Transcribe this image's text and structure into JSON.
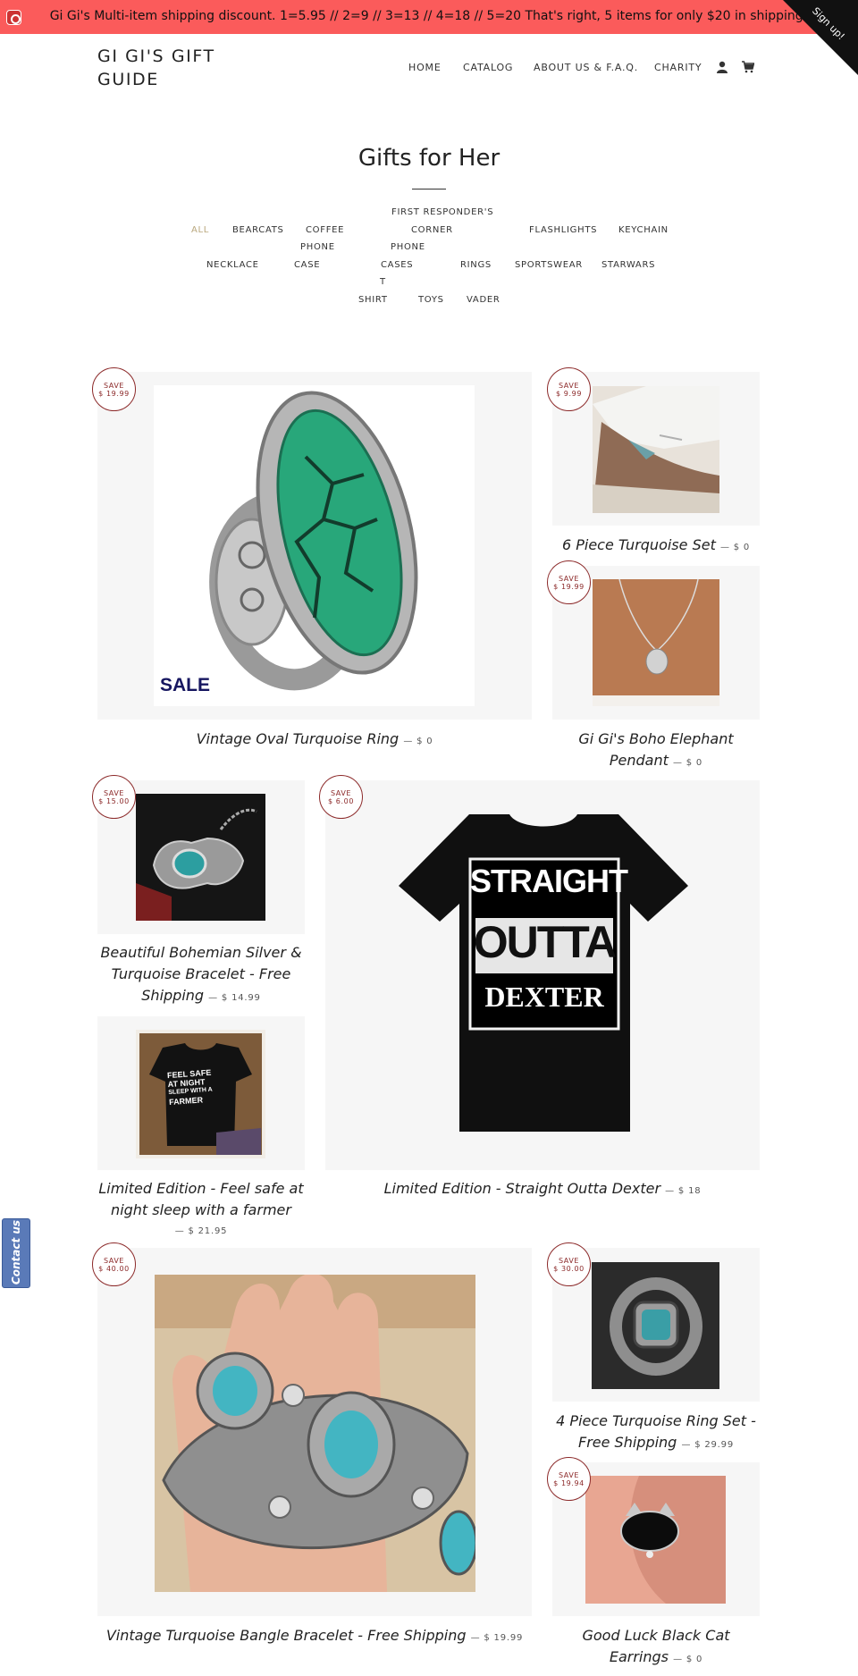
{
  "announcement": {
    "text": "Gi Gi's Multi-item shipping discount. 1=5.95 // 2=9 // 3=13 // 4=18 // 5=20 That's right, 5 items for only $20 in shipping!",
    "signup": "Sign up!"
  },
  "header": {
    "logo": "GI GI'S GIFT GUIDE",
    "nav": [
      "HOME",
      "CATALOG",
      "ABOUT US & F.A.Q.",
      "CHARITY"
    ]
  },
  "collection": {
    "title": "Gifts for Her",
    "tags": {
      "all": "ALL",
      "bearcats": "BEARCATS",
      "coffee": "COFFEE",
      "first_responders_line1": "FIRST RESPONDER'S",
      "first_responders_line2": "CORNER",
      "flashlights": "FLASHLIGHTS",
      "keychain": "KEYCHAIN",
      "necklace": "NECKLACE",
      "phone_case_line1": "PHONE",
      "phone_case_line2": "CASE",
      "phone_cases_line1": "PHONE",
      "phone_cases_line2": "CASES",
      "rings": "RINGS",
      "sportswear": "SPORTSWEAR",
      "starwars": "STARWARS",
      "tshirt_line1": "T",
      "tshirt_line2": "SHIRT",
      "toys": "TOYS",
      "vader": "VADER"
    }
  },
  "badge_word": "SAVE",
  "products": [
    {
      "title": "Vintage Oval Turquoise Ring",
      "price": "— $ 0",
      "save": "$ 19.99",
      "image_text": "SALE"
    },
    {
      "title": "6 Piece Turquoise Set",
      "price": "— $ 0",
      "save": "$ 9.99"
    },
    {
      "title": "Gi Gi's Boho Elephant Pendant",
      "title_line1": "Gi Gi's Boho Elephant",
      "title_line2": "Pendant",
      "price": "— $ 0",
      "save": "$ 19.99"
    },
    {
      "title": "Beautiful Bohemian Silver & Turquoise Bracelet - Free Shipping",
      "title_line1": "Beautiful Bohemian Silver &",
      "title_line2": "Turquoise Bracelet - Free",
      "title_line3": "Shipping",
      "price": "— $ 14.99",
      "save": "$ 15.00"
    },
    {
      "title": "Limited Edition - Straight Outta Dexter",
      "price": "— $ 18",
      "save": "$ 6.00",
      "image_text": [
        "STRAIGHT",
        "OUTTA",
        "DEXTER"
      ]
    },
    {
      "title": "Limited Edition - Feel safe at night sleep with a farmer",
      "title_line1": "Limited Edition - Feel safe at",
      "title_line2": "night sleep with a farmer",
      "price": "— $ 21.95",
      "image_text": [
        "FEEL SAFE",
        "AT NIGHT",
        "SLEEP WITH A",
        "FARMER"
      ]
    },
    {
      "title": "Vintage Turquoise Bangle Bracelet - Free Shipping",
      "price": "— $ 19.99",
      "save": "$ 40.00"
    },
    {
      "title": "4 Piece Turquoise Ring Set - Free Shipping",
      "title_line1": "4 Piece Turquoise Ring Set -",
      "title_line2": "Free Shipping",
      "price": "— $ 29.99",
      "save": "$ 30.00"
    },
    {
      "title": "Good Luck Black Cat Earrings",
      "title_line1": "Good Luck Black Cat",
      "title_line2": "Earrings",
      "price": "— $ 0",
      "save": "$ 19.94"
    }
  ],
  "contact_tab": "Contact us",
  "colors": {
    "announcement_bg": "#fb5b5b",
    "badge": "#8c2a2a",
    "active_tag": "#b9a77d",
    "card_bg": "#f6f6f6",
    "contact_tab": "#5a7ab8"
  }
}
